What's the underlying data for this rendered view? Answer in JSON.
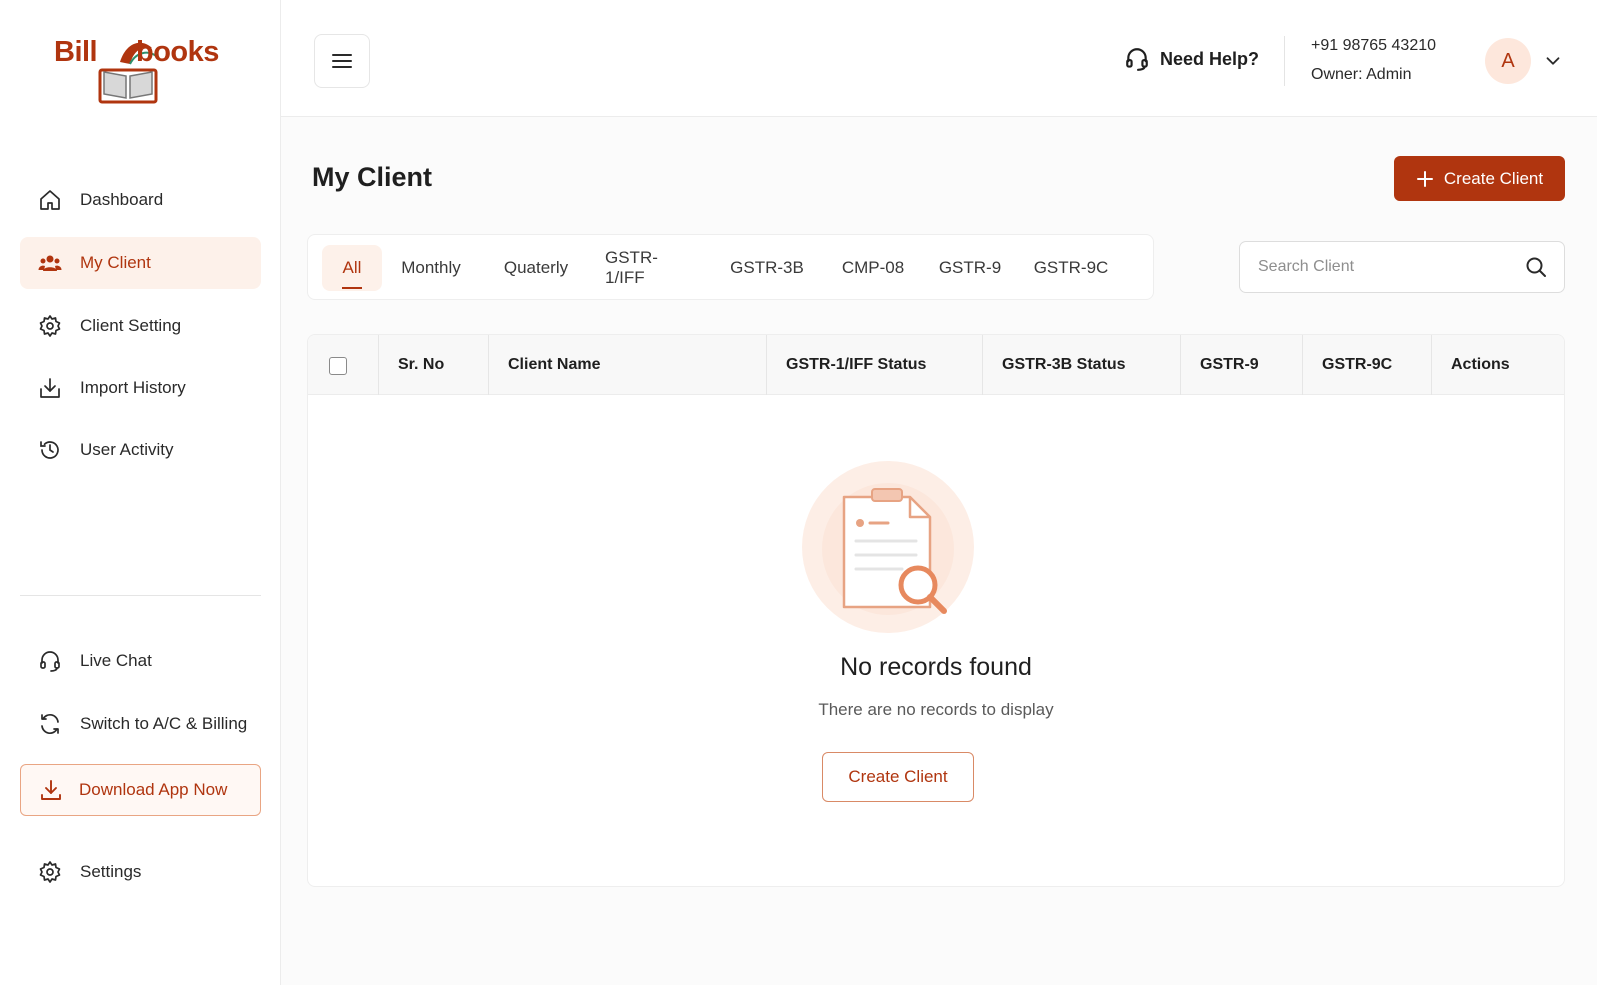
{
  "brand": {
    "logo_text_left": "Bill",
    "logo_text_right": "books",
    "accent_color": "#b0350f"
  },
  "sidebar": {
    "items": [
      {
        "label": "Dashboard",
        "icon": "home-icon"
      },
      {
        "label": "My Client",
        "icon": "users-icon",
        "active": true
      },
      {
        "label": "Client Setting",
        "icon": "gear-icon"
      },
      {
        "label": "Import History",
        "icon": "import-icon"
      },
      {
        "label": "User Activity",
        "icon": "history-icon"
      }
    ],
    "bottom_items": [
      {
        "label": "Live Chat",
        "icon": "headset-icon"
      },
      {
        "label": "Switch to A/C & Billing",
        "icon": "switch-icon"
      }
    ],
    "download_label": "Download App Now",
    "settings_label": "Settings"
  },
  "header": {
    "help_label": "Need Help?",
    "phone": "+91 98765 43210",
    "owner": "Owner: Admin",
    "avatar_initial": "A"
  },
  "main": {
    "title": "My Client",
    "create_button_label": "Create Client",
    "tabs": [
      "All",
      "Monthly",
      "Quaterly",
      "GSTR-1/IFF",
      "GSTR-3B",
      "CMP-08",
      "GSTR-9",
      "GSTR-9C"
    ],
    "active_tab": "All",
    "search_placeholder": "Search Client",
    "table": {
      "columns": [
        "Sr. No",
        "Client Name",
        "GSTR-1/IFF Status",
        "GSTR-3B Status",
        "GSTR-9",
        "GSTR-9C",
        "Actions"
      ],
      "rows": []
    },
    "empty_state": {
      "title": "No records found",
      "subtitle": "There are no records to display",
      "button_label": "Create Client"
    }
  }
}
